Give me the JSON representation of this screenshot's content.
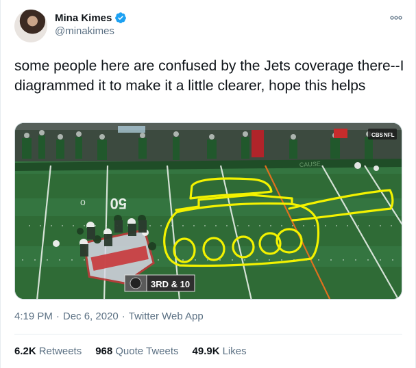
{
  "author": {
    "display_name": "Mina Kimes",
    "handle": "@minakimes"
  },
  "icons": [
    "verified-badge-icon",
    "more-options-icon"
  ],
  "tweet": {
    "text": "some people here are confused by the Jets coverage there--I diagrammed it to make it a little clearer, hope this helps"
  },
  "media": {
    "scoreboard_logo": "NFL",
    "network": "CBS",
    "down_distance": "3RD & 10",
    "yard_marker": "50",
    "field_lettering": "CAUSE",
    "drawing": "tank"
  },
  "meta": {
    "time": "4:19 PM",
    "date": "Dec 6, 2020",
    "separator": "·",
    "source": "Twitter Web App"
  },
  "stats": {
    "retweets_count": "6.2K",
    "retweets_label": "Retweets",
    "quote_count": "968",
    "quote_label": "Quote Tweets",
    "likes_count": "49.9K",
    "likes_label": "Likes"
  },
  "colors": {
    "verified_blue": "#1da1f2",
    "drawing_yellow": "#f3f200",
    "field_green": "#2f6b36",
    "secondary_text": "#5b7083"
  }
}
